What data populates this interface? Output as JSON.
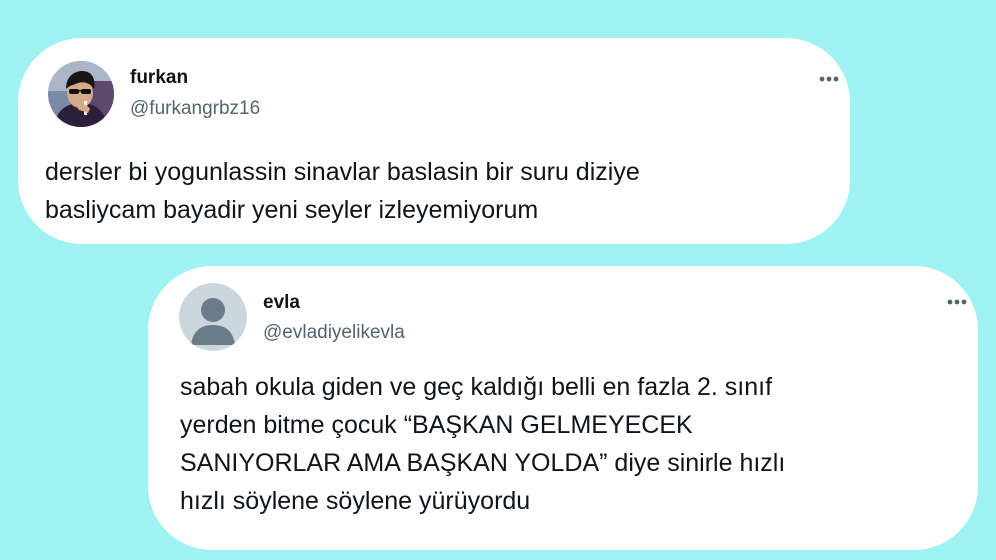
{
  "tweets": [
    {
      "name": "furkan",
      "handle": "@furkangrbz16",
      "avatar": "profile-photo",
      "lines": [
        "dersler bi yogunlassin sinavlar baslasin bir suru diziye",
        "basliycam bayadir yeni seyler izleyemiyorum"
      ]
    },
    {
      "name": "evla",
      "handle": "@evladiyelikevla",
      "avatar": "default-profile",
      "lines": [
        "sabah okula giden ve geç kaldığı belli en fazla 2. sınıf",
        "yerden bitme çocuk “BAŞKAN GELMEYECEK",
        "SANIYORLAR AMA BAŞKAN YOLDA” diye sinirle hızlı",
        "hızlı söylene söylene yürüyordu"
      ]
    }
  ],
  "icons": {
    "more": "more-options-icon"
  },
  "colors": {
    "background": "#9ff3f3",
    "card": "#ffffff",
    "handle": "#536471",
    "text": "#0f1419",
    "default_avatar_bg": "#ccd6dd",
    "default_avatar_fg": "#6b7c88"
  }
}
